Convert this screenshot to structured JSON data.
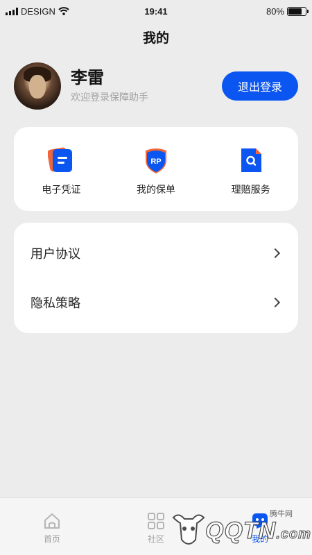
{
  "status_bar": {
    "carrier": "DESIGN",
    "time": "19:41",
    "battery_text": "80%",
    "battery_level": 0.8
  },
  "header": {
    "title": "我的"
  },
  "profile": {
    "name": "李雷",
    "subtitle": "欢迎登录保障助手",
    "logout_label": "退出登录"
  },
  "shortcuts": [
    {
      "label": "电子凭证",
      "icon": "e-certificate-icon"
    },
    {
      "label": "我的保单",
      "icon": "policy-shield-icon",
      "icon_text": "RP"
    },
    {
      "label": "理赔服务",
      "icon": "claim-search-icon"
    }
  ],
  "menu": [
    {
      "label": "用户协议"
    },
    {
      "label": "隐私策略"
    }
  ],
  "tabs": [
    {
      "label": "首页",
      "icon": "home-icon",
      "active": false
    },
    {
      "label": "社区",
      "icon": "grid-icon",
      "active": false
    },
    {
      "label": "我的",
      "icon": "profile-bubble-icon",
      "active": true
    }
  ],
  "watermark": {
    "text": "QQTN",
    "suffix": ".com",
    "cn": "腾牛网"
  },
  "colors": {
    "accent": "#0b56f0",
    "background": "#ececec",
    "card": "#ffffff",
    "muted": "#a3a3a3"
  }
}
